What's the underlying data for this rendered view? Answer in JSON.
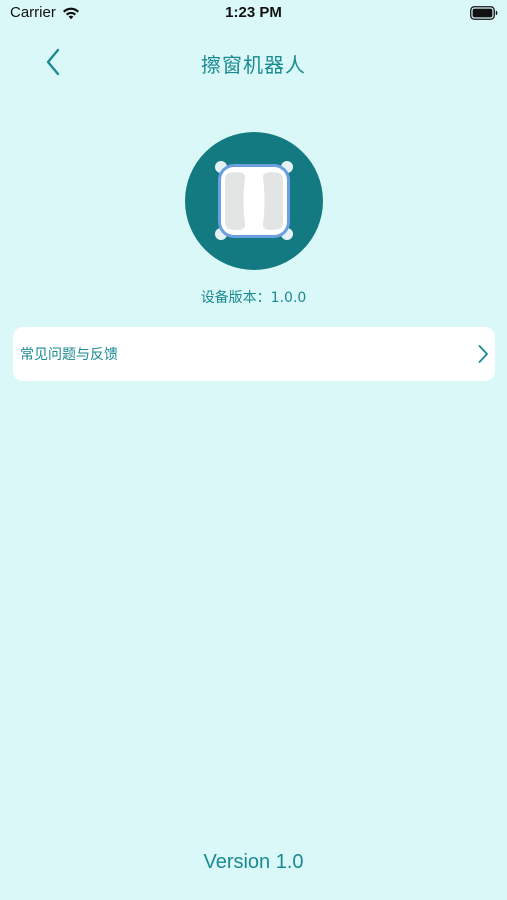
{
  "status_bar": {
    "carrier": "Carrier",
    "time": "1:23 PM",
    "wifi_icon": "wifi-icon",
    "battery_icon": "battery-icon"
  },
  "nav": {
    "back_icon": "chevron-left-icon",
    "title": "擦窗机器人"
  },
  "device": {
    "image_icon": "window-cleaning-robot-icon",
    "version_text": "设备版本：1.0.0"
  },
  "menu": {
    "items": [
      {
        "label": "常见问题与反馈",
        "icon": "chevron-right-icon"
      }
    ]
  },
  "footer": {
    "app_version": "Version 1.0"
  },
  "colors": {
    "background": "#dbf8f9",
    "accent": "#1a8a92",
    "device_circle": "#137a82",
    "card": "#ffffff"
  }
}
